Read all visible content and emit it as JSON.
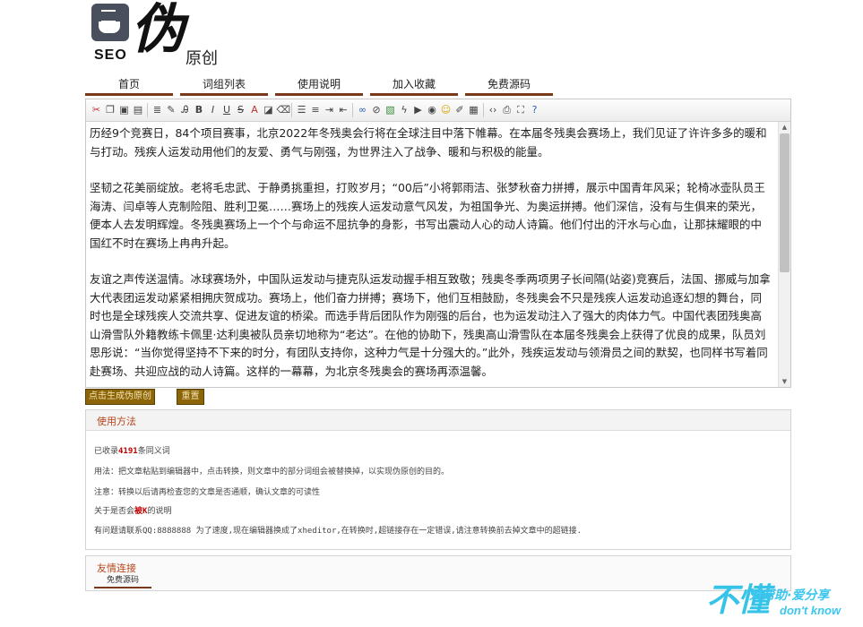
{
  "logo": {
    "seo_text": "SEO",
    "big_char": "伪",
    "small_text": "原创"
  },
  "nav": {
    "items": [
      "首页",
      "词组列表",
      "使用说明",
      "加入收藏",
      "免费源码"
    ]
  },
  "toolbar": {
    "icons": [
      "cut-icon",
      "copy-icon",
      "paste-icon",
      "paste-text-icon",
      "sep",
      "select-all-icon",
      "remove-format-icon",
      "font-icon",
      "bold-icon",
      "italic-icon",
      "underline-icon",
      "strikethrough-icon",
      "font-color-icon",
      "highlight-icon",
      "eraser-icon",
      "sep",
      "align-left-icon",
      "list-icon",
      "indent-icon",
      "outdent-icon",
      "sep",
      "link-icon",
      "unlink-icon",
      "image-icon",
      "flash-icon",
      "media-icon",
      "emoticon-icon",
      "smiley-icon",
      "edit-icon",
      "table-icon",
      "sep",
      "source-icon",
      "preview-icon",
      "fullscreen-icon",
      "help-icon"
    ],
    "glyphs": {
      "bold-icon": "B",
      "italic-icon": "I",
      "underline-icon": "U",
      "strikethrough-icon": "S",
      "font-color-icon": "A"
    }
  },
  "editor": {
    "paragraphs": [
      "历经9个竞赛日，84个项目赛事，北京2022年冬残奥会行将在全球注目中落下帷幕。在本届冬残奥会赛场上，我们见证了许许多多的暖和与打动。残疾人运发动用他们的友爱、勇气与刚强，为世界注入了战争、暖和与积极的能量。",
      "坚韧之花美丽绽放。老将毛忠武、于静勇挑重担，打败岁月；“00后”小将郭雨洁、张梦秋奋力拼搏，展示中国青年风采；轮椅冰壶队员王海涛、闫卓等人克制险阻、胜利卫冕……赛场上的残疾人运发动意气风发，为祖国争光、为奥运拼搏。他们深信，没有与生俱来的荣光，便本人去发明辉煌。冬残奥赛场上一个个与命运不屈抗争的身影，书写出震动人心的动人诗篇。他们付出的汗水与心血，让那抹耀眼的中国红不时在赛场上冉冉升起。",
      "友谊之声传送温情。冰球赛场外，中国队运发动与捷克队运发动握手相互致敬；残奥冬季两项男子长间隔(站姿)竞赛后，法国、挪威与加拿大代表团运发动紧紧相拥庆贺成功。赛场上，他们奋力拼搏；赛场下，他们互相鼓励，冬残奥会不只是残疾人运发动追逐幻想的舞台，同时也是全球残疾人交流共享、促进友谊的桥梁。而选手背后团队作为刚强的后台，也为运发动注入了强大的肉体力气。中国代表团残奥高山滑雪队外籍教练卡佩里·达利奥被队员亲切地称为“老达”。在他的协助下，残奥高山滑雪队在本届冬残奥会上获得了优良的成果，队员刘思彤说：“当你觉得坚持不下来的时分，有团队支持你，这种力气是十分强大的。”此外，残疾运发动与领滑员之间的默契，也同样书写着同赴赛场、共迎应战的动人诗篇。这样的一幕幕，为北京冬残奥会的赛场再添温馨。"
    ]
  },
  "buttons": {
    "generate": "点击生成伪原创",
    "reset": "重置"
  },
  "usage": {
    "title": "使用方法",
    "count_prefix": "已收录",
    "count": "4191",
    "count_suffix": "条同义词",
    "line_usage": "用法：把文章粘贴到编辑器中，点击转换，则文章中的部分词组会被替换掉，以实现伪原创的目的。",
    "line_note": "注意：转换以后请再检查您的文章是否通顺，确认文章的可读性",
    "line_k_prefix": "关于是否会",
    "line_k_red": "被K",
    "line_k_suffix": "的说明",
    "line_contact": "有问题请联系QQ:8888888 为了速度,现在编辑器换成了xheditor,在转换时,超链接存在一定错误,请注意转换前去掉文章中的超链接."
  },
  "friend_links": {
    "title": "友情连接",
    "items": [
      "免费源码"
    ]
  },
  "watermark": {
    "big": "不懂",
    "cn": "爱帮助·爱分享",
    "en": "don't know"
  },
  "colors": {
    "nav_underline": "#7a3a1a",
    "button_bg": "#8b6508",
    "panel_title": "#b5451b",
    "count_red": "#c00000"
  }
}
